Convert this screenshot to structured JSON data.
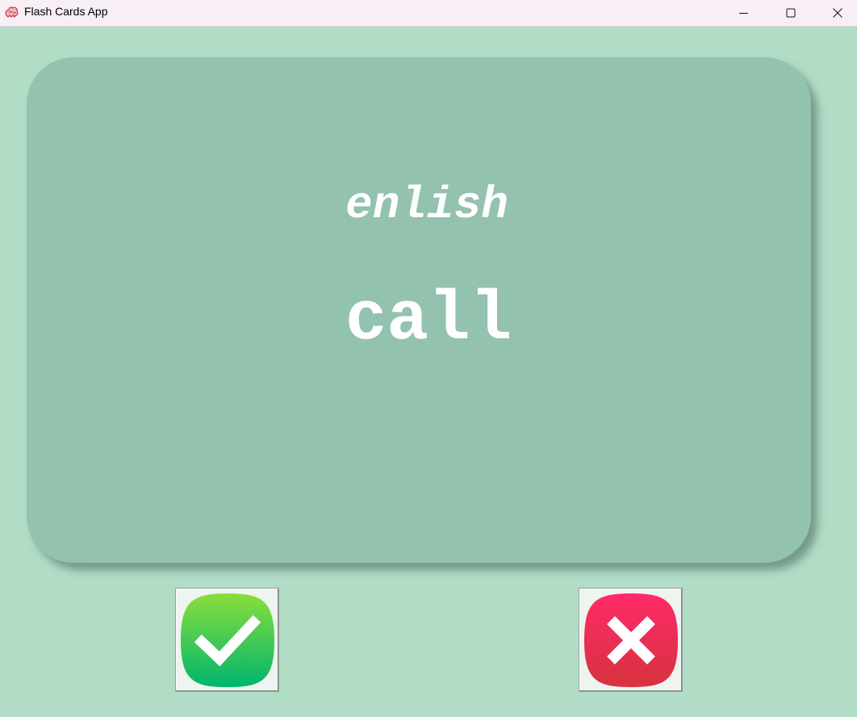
{
  "window": {
    "title": "Flash Cards App",
    "app_icon": "brain-icon",
    "controls": {
      "minimize_icon": "minimize-icon",
      "maximize_icon": "maximize-icon",
      "close_icon": "close-icon"
    }
  },
  "card": {
    "language": "enlish",
    "word": "call"
  },
  "buttons": {
    "right": {
      "icon": "checkmark-icon",
      "color_top": "#8ade3b",
      "color_bottom": "#00b56e"
    },
    "wrong": {
      "icon": "cross-icon",
      "color_top": "#ff2a68",
      "color_bottom": "#d6333f"
    }
  },
  "colors": {
    "background": "#b1dcc6",
    "card": "#93c2af",
    "card_text": "#ffffff"
  }
}
